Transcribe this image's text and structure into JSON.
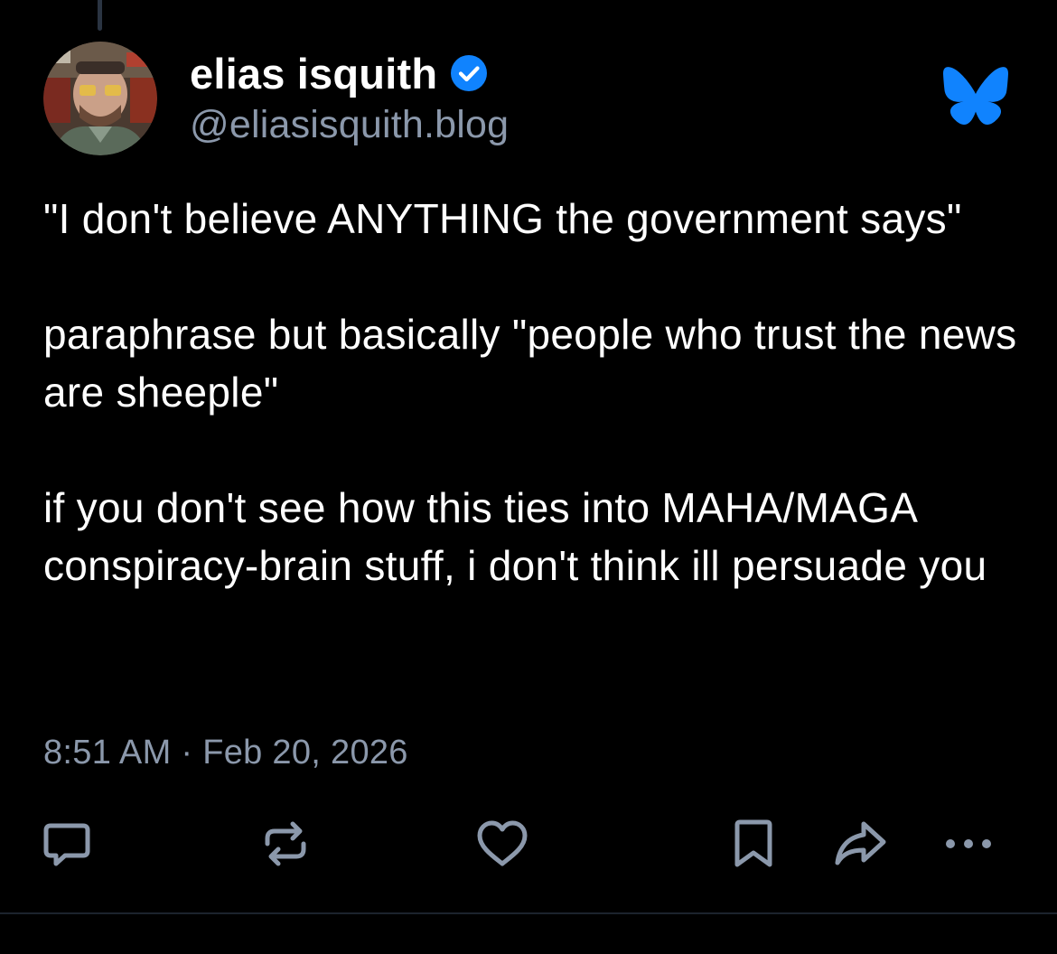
{
  "post": {
    "author": {
      "display_name": "elias isquith",
      "handle": "@eliasisquith.blog",
      "verified": true,
      "verified_color": "#1083fe",
      "avatar": "user-avatar-photo"
    },
    "body": {
      "paragraph_1": "\"I don't believe ANYTHING the government says\"",
      "paragraph_2": "paraphrase but basically \"people who trust the news are sheeple\"",
      "paragraph_3": "if you don't see how this ties into MAHA/MAGA conspiracy-brain stuff, i don't think ill persuade you"
    },
    "timestamp": "8:51 AM · Feb 20, 2026"
  },
  "actions": {
    "reply": "reply-icon",
    "repost": "repost-icon",
    "like": "like-icon",
    "bookmark": "bookmark-icon",
    "share": "share-icon",
    "more": "more-icon"
  },
  "brand": {
    "logo": "bluesky-butterfly-icon",
    "accent_color": "#1083fe"
  },
  "colors": {
    "background": "#000000",
    "text_primary": "#ffffff",
    "text_secondary": "#8b98ab"
  }
}
